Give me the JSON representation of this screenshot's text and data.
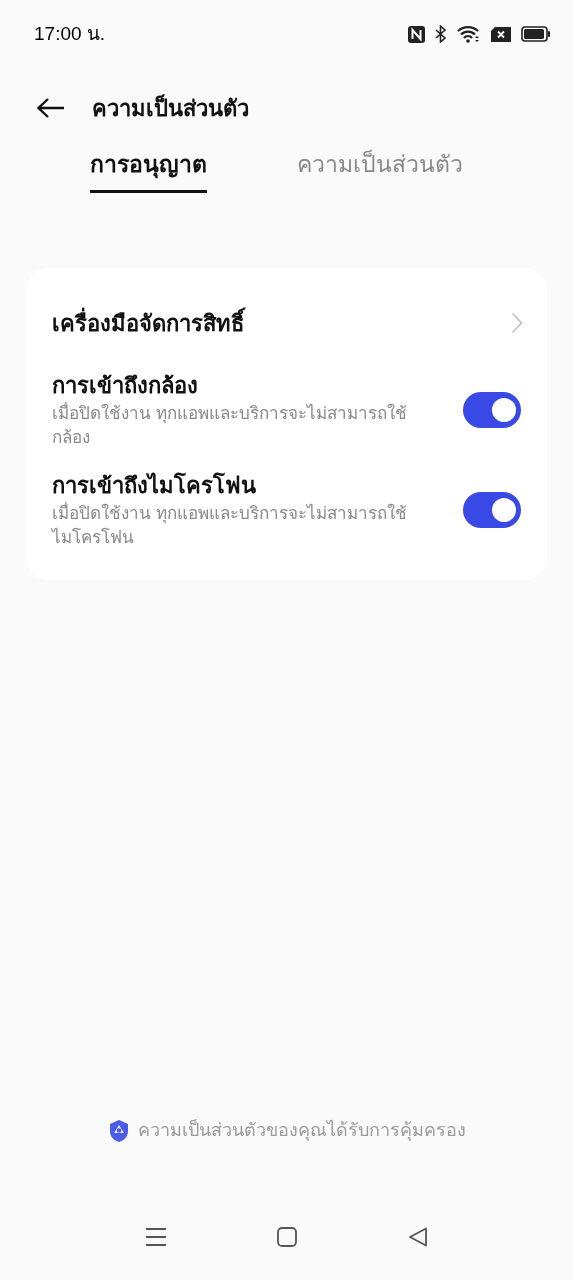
{
  "status_bar": {
    "time": "17:00 น."
  },
  "header": {
    "title": "ความเป็นส่วนตัว"
  },
  "tabs": [
    {
      "label": "การอนุญาต",
      "selected": true
    },
    {
      "label": "ความเป็นส่วนตัว",
      "selected": false
    }
  ],
  "settings": [
    {
      "kind": "link",
      "title": "เครื่องมือจัดการสิทธิ์"
    },
    {
      "kind": "toggle",
      "title": "การเข้าถึงกล้อง",
      "description": "เมื่อปิดใช้งาน ทุกแอพและบริการจะไม่สามารถใช้กล้อง",
      "on": true
    },
    {
      "kind": "toggle",
      "title": "การเข้าถึงไมโครโฟน",
      "description": "เมื่อปิดใช้งาน ทุกแอพและบริการจะไม่สามารถใช้ไมโครโฟน",
      "on": true
    }
  ],
  "footer": {
    "text": "ความเป็นส่วนตัวของคุณได้รับการคุ้มครอง"
  }
}
